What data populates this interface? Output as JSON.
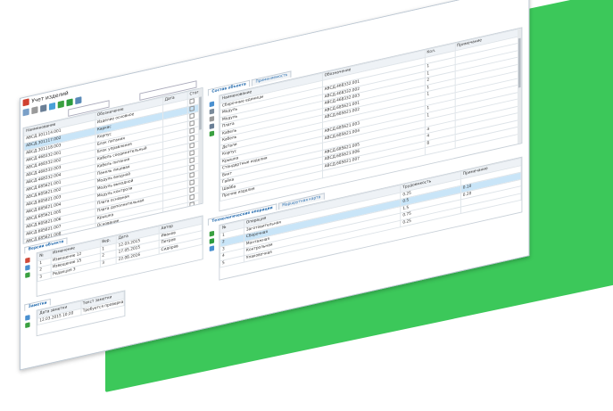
{
  "window": {
    "title": "Учет изделий",
    "minimize_glyph": "–",
    "maximize_glyph": "□",
    "close_glyph": "✕"
  },
  "colors": {
    "accent_green": "#3cc85a",
    "selection_blue": "#c9e5f8",
    "tab_text_blue": "#2a6fb0"
  },
  "toolbar": {
    "icons": [
      "add-icon",
      "delete-icon",
      "save-icon",
      "refresh-icon",
      "funnel-icon",
      "filter-icon",
      "export-icon"
    ]
  },
  "left_table": {
    "headers": [
      "Наименование",
      "Обозначение",
      "Дата",
      "Статус"
    ],
    "rows": [
      [
        "АВСД.301114.001",
        "Изделие основное",
        "",
        ""
      ],
      [
        "АВСД.301117.002",
        "Каркас",
        "",
        ""
      ],
      [
        "АВСД.301118.003",
        "Корпус",
        "",
        ""
      ],
      [
        "АВСД.468332.001",
        "Блок питания",
        "",
        ""
      ],
      [
        "АВСД.468332.002",
        "Блок управления",
        "",
        ""
      ],
      [
        "АВСД.468332.003",
        "Кабель соединительный",
        "",
        ""
      ],
      [
        "АВСД.468332.004",
        "Кабель питания",
        "",
        ""
      ],
      [
        "АВСД.685621.001",
        "Панель лицевая",
        "",
        ""
      ],
      [
        "АВСД.685621.002",
        "Модуль входной",
        "",
        ""
      ],
      [
        "АВСД.685621.003",
        "Модуль выходной",
        "",
        ""
      ],
      [
        "АВСД.685621.004",
        "Модуль контроля",
        "",
        ""
      ],
      [
        "АВСД.685621.005",
        "Плата основная",
        "",
        ""
      ],
      [
        "АВСД.685621.006",
        "Плата дополнительная",
        "",
        ""
      ],
      [
        "АВСД.685621.007",
        "Крышка",
        "",
        ""
      ],
      [
        "АВСД.685621.008",
        "Основание",
        "",
        ""
      ]
    ]
  },
  "versions_panel": {
    "tab_label": "Версии объекта",
    "headers": [
      "№",
      "Изменение",
      "Вер.",
      "Дата",
      "Автор"
    ],
    "rows": [
      [
        "1",
        "Извещение 12",
        "1",
        "12.03.2015",
        "Иванов"
      ],
      [
        "2",
        "Извещение 15",
        "2",
        "17.05.2015",
        "Петров"
      ],
      [
        "3",
        "Редакция 3",
        "3",
        "22.08.2016",
        "Сидоров"
      ]
    ]
  },
  "notes_panel": {
    "tab_label": "Заметки",
    "headers": [
      "Дата заметки",
      "Текст заметки"
    ],
    "rows": [
      [
        "12.03.2015 10:20",
        "Требуется проверка"
      ]
    ]
  },
  "composition_panel": {
    "tabs": [
      "Состав объекта",
      "Применяемость"
    ],
    "headers": [
      "Наименование",
      "Обозначение",
      "Кол.",
      "Примечание"
    ],
    "rows": [
      [
        "Сборочные единицы",
        "",
        "",
        ""
      ],
      [
        "Модуль",
        "АВСД.468332.001",
        "1",
        ""
      ],
      [
        "Модуль",
        "АВСД.468332.002",
        "1",
        ""
      ],
      [
        "Плата",
        "АВСД.468332.003",
        "2",
        ""
      ],
      [
        "Кабель",
        "АВСД.685621.001",
        "1",
        ""
      ],
      [
        "Кабель",
        "АВСД.685621.002",
        "1",
        ""
      ],
      [
        "Детали",
        "",
        "",
        ""
      ],
      [
        "Корпус",
        "АВСД.685621.003",
        "1",
        ""
      ],
      [
        "Крышка",
        "АВСД.685621.004",
        "1",
        ""
      ],
      [
        "Стандартные изделия",
        "",
        "",
        ""
      ],
      [
        "Винт",
        "АВСД.685621.005",
        "4",
        ""
      ],
      [
        "Гайка",
        "АВСД.685621.006",
        "4",
        ""
      ],
      [
        "Шайба",
        "АВСД.685621.007",
        "8",
        ""
      ],
      [
        "Прочие изделия",
        "",
        "",
        ""
      ]
    ]
  },
  "operations_panel": {
    "tabs": [
      "Технологические операции",
      "Маршрутная карта"
    ],
    "headers": [
      "№",
      "Операция",
      "Трудоемкость",
      "Примечание"
    ],
    "rows": [
      [
        "1",
        "Заготовительная",
        "0.25",
        ""
      ],
      [
        "2",
        "Сборочная",
        "0.5",
        "0.10"
      ],
      [
        "3",
        "Монтажная",
        "1.5",
        "0.20"
      ],
      [
        "4",
        "Контрольная",
        "0.75",
        ""
      ],
      [
        "5",
        "Упаковочная",
        "0.25",
        ""
      ]
    ]
  }
}
